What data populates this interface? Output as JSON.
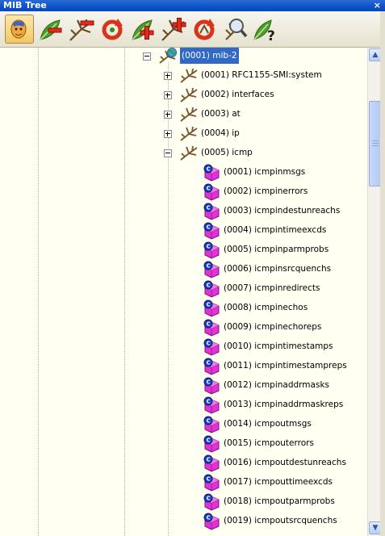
{
  "window": {
    "title": "MIB Tree",
    "close_label": "×"
  },
  "toolbar": {
    "buttons": [
      {
        "name": "tree-view-button",
        "icon": "face-icon"
      },
      {
        "name": "collapse-leaf-button",
        "icon": "leaf-minus-icon"
      },
      {
        "name": "collapse-branch-button",
        "icon": "branch-minus-icon"
      },
      {
        "name": "refresh-button",
        "icon": "refresh-icon"
      },
      {
        "name": "expand-leaf-button",
        "icon": "leaf-plus-icon"
      },
      {
        "name": "expand-branch-button",
        "icon": "branch-plus-icon"
      },
      {
        "name": "reload-button",
        "icon": "reload-icon"
      },
      {
        "name": "search-button",
        "icon": "magnifier-icon"
      },
      {
        "name": "help-button",
        "icon": "leaf-question-icon"
      }
    ]
  },
  "tree": {
    "root": {
      "label": "(0001) mib-2",
      "icon": "globe-branch-icon",
      "selected": true,
      "expanded": true
    },
    "children": [
      {
        "label": "(0001) RFC1155-SMI:system",
        "icon": "branch-icon",
        "expanded": false
      },
      {
        "label": "(0002) interfaces",
        "icon": "branch-icon",
        "expanded": false
      },
      {
        "label": "(0003) at",
        "icon": "branch-icon",
        "expanded": false
      },
      {
        "label": "(0004) ip",
        "icon": "branch-icon",
        "expanded": false
      },
      {
        "label": "(0005) icmp",
        "icon": "branch-icon",
        "expanded": true
      }
    ],
    "icmp_leaves": [
      "(0001) icmpinmsgs",
      "(0002) icmpinerrors",
      "(0003) icmpindestunreachs",
      "(0004) icmpintimeexcds",
      "(0005) icmpinparmprobs",
      "(0006) icmpinsrcquenchs",
      "(0007) icmpinredirects",
      "(0008) icmpinechos",
      "(0009) icmpinechoreps",
      "(0010) icmpintimestamps",
      "(0011) icmpintimestampreps",
      "(0012) icmpinaddrmasks",
      "(0013) icmpinaddrmaskreps",
      "(0014) icmpoutmsgs",
      "(0015) icmpouterrors",
      "(0016) icmpoutdestunreachs",
      "(0017) icmpouttimeexcds",
      "(0018) icmpoutparmprobs",
      "(0019) icmpoutsrcquenchs"
    ],
    "leaf_icon": "counter-cube-icon"
  },
  "scrollbar": {
    "up_icon": "up-arrow-icon",
    "down_icon": "down-arrow-icon"
  },
  "colors": {
    "title_bar": "#0b52c8",
    "selection": "#3169c6",
    "tree_bg": "#fffff2",
    "cube": "#e232d6"
  }
}
